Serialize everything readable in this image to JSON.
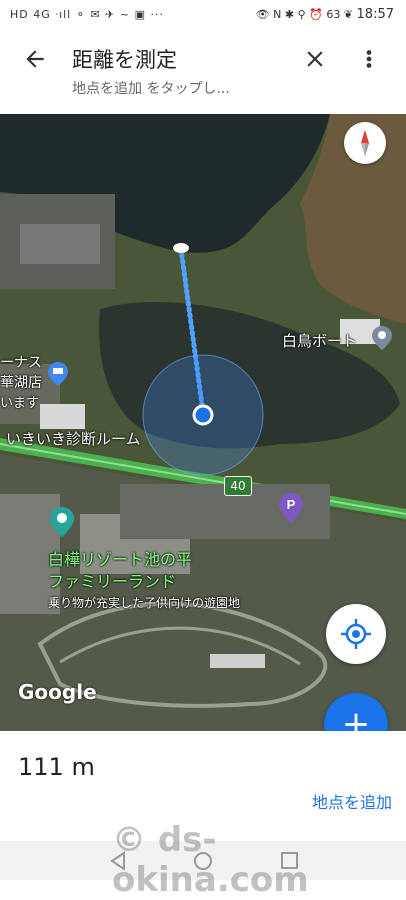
{
  "status_bar": {
    "left": "HD 4G ᐧıll ⚬ ✉ ✈ ~ ▣ ···",
    "right": "👁 N ✱ ⚲ ⏰ 63 ❦",
    "time": "18:57"
  },
  "header": {
    "back_icon": "arrow-left-icon",
    "title": "距離を測定",
    "subtitle": "地点を追加 をタップし...",
    "close_icon": "close-icon",
    "more_icon": "more-vert-icon"
  },
  "map": {
    "labels": {
      "boat": "白鳥ボート",
      "shop_partial": "ーナス",
      "shop_partial2": "華湖店",
      "shop_partial3": "います",
      "clinic": "いきいき診断ルーム",
      "road": "40",
      "parking": "P",
      "resort_name_1": "白樺リゾート池の平",
      "resort_name_2": "ファミリーランド",
      "resort_desc": "乗り物が充実した子供向けの遊園地"
    },
    "google_logo": "Google",
    "compass_icon": "compass-icon",
    "locate_icon": "my-location-icon",
    "add_icon": "plus-icon"
  },
  "bottom": {
    "distance": "111 m",
    "add_point": "地点を追加"
  },
  "watermark": "© ds-okina.com",
  "colors": {
    "accent": "#1a73e8",
    "road_green": "#4caf50"
  }
}
